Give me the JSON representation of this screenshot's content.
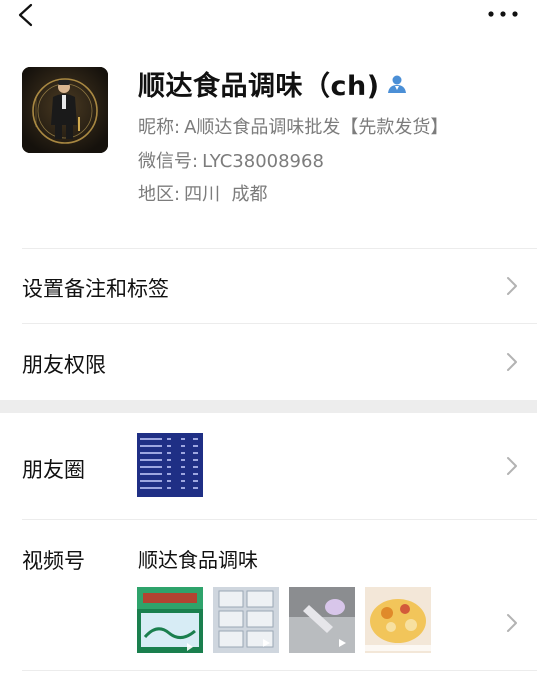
{
  "profile": {
    "name": "顺达食品调味（ch)",
    "nickname_label": "昵称:",
    "nickname": "A顺达食品调味批发【先款发货】",
    "wechat_id_label": "微信号:",
    "wechat_id": "LYC38008968",
    "region_label": "地区:",
    "region": "四川  成都"
  },
  "rows": {
    "remark_tags": "设置备注和标签",
    "friend_permissions": "朋友权限",
    "moments": "朋友圈",
    "channels": "视频号"
  },
  "channels": {
    "title": "顺达食品调味"
  },
  "icons": [
    "back-arrow-icon",
    "more-icon",
    "verified-person-icon",
    "chevron-right-icon",
    "video-play-icon"
  ],
  "colors": {
    "verified": "#4b8fd6",
    "secondary_text": "#7c7c7c",
    "section_gap": "#ededed"
  }
}
